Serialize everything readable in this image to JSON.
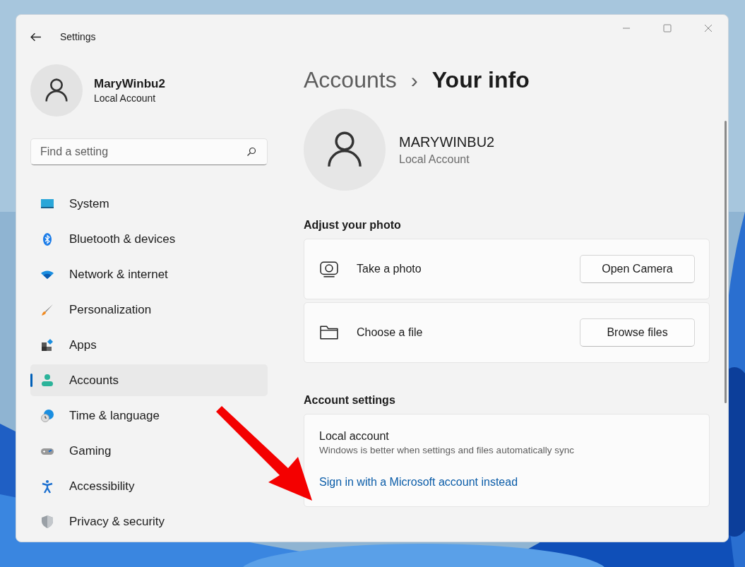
{
  "window": {
    "title": "Settings"
  },
  "user": {
    "name": "MaryWinbu2",
    "account_type": "Local Account"
  },
  "search": {
    "placeholder": "Find a setting"
  },
  "nav": [
    {
      "label": "System",
      "selected": false
    },
    {
      "label": "Bluetooth & devices",
      "selected": false
    },
    {
      "label": "Network & internet",
      "selected": false
    },
    {
      "label": "Personalization",
      "selected": false
    },
    {
      "label": "Apps",
      "selected": false
    },
    {
      "label": "Accounts",
      "selected": true
    },
    {
      "label": "Time & language",
      "selected": false
    },
    {
      "label": "Gaming",
      "selected": false
    },
    {
      "label": "Accessibility",
      "selected": false
    },
    {
      "label": "Privacy & security",
      "selected": false
    }
  ],
  "breadcrumb": {
    "parent": "Accounts",
    "separator": "›",
    "current": "Your info"
  },
  "profile": {
    "name": "MARYWINBU2",
    "account_type": "Local Account"
  },
  "photo_section": {
    "heading": "Adjust your photo",
    "rows": [
      {
        "kind": "camera",
        "label": "Take a photo",
        "button": "Open Camera"
      },
      {
        "kind": "file",
        "label": "Choose a file",
        "button": "Browse files"
      }
    ]
  },
  "account_section": {
    "heading": "Account settings",
    "title": "Local account",
    "description": "Windows is better when settings and files automatically sync",
    "link": "Sign in with a Microsoft account instead"
  }
}
